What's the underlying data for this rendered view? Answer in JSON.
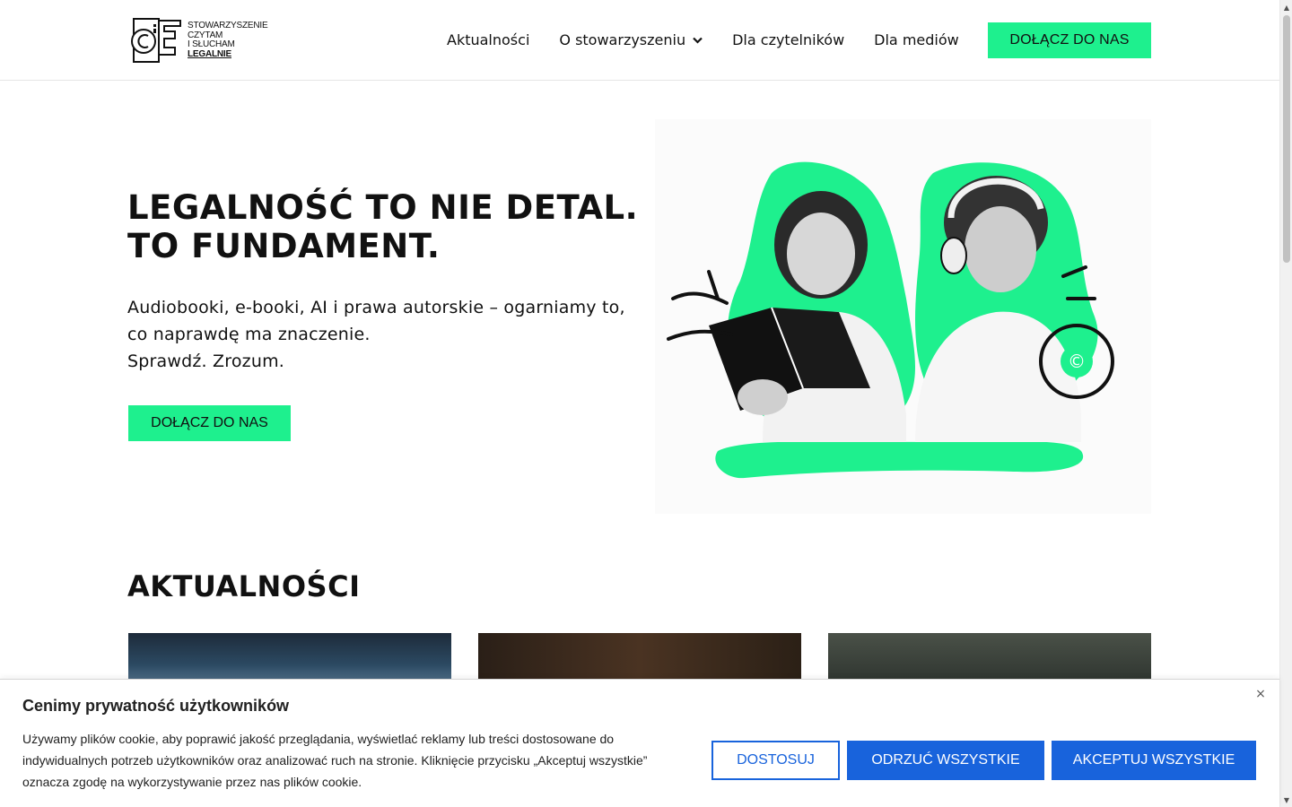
{
  "brand": {
    "logo_lines": [
      "STOWARZYSZENIE",
      "CZYTAM",
      "I SŁUCHAM"
    ],
    "logo_bold": "LEGALNIE"
  },
  "nav": {
    "items": [
      {
        "label": "Aktualności"
      },
      {
        "label": "O stowarzyszeniu",
        "has_dropdown": true
      },
      {
        "label": "Dla czytelników"
      },
      {
        "label": "Dla mediów"
      }
    ],
    "cta_label": "DOŁĄCZ DO NAS"
  },
  "hero": {
    "title_lines": [
      "LEGALNOŚĆ TO NIE DETAL.",
      "TO FUNDAMENT."
    ],
    "subtitle_lines": [
      "Audiobooki, e-booki, AI i prawa autorskie – ogarniamy to,",
      "co naprawdę ma znaczenie.",
      "Sprawdź. Zrozum."
    ],
    "cta_label": "DOŁĄCZ DO NAS",
    "accent_color": "#1ef08e"
  },
  "news": {
    "title": "AKTUALNOŚCI"
  },
  "cookie_banner": {
    "title": "Cenimy prywatność użytkowników",
    "text_lines": [
      "Używamy plików cookie, aby poprawić jakość przeglądania, wyświetlać reklamy lub treści dostosowane do",
      "indywidualnych potrzeb użytkowników oraz analizować ruch na stronie. Kliknięcie przycisku „Akceptuj wszystkie”",
      "oznacza zgodę na wykorzystywanie przez nas plików cookie."
    ],
    "close_icon": "×",
    "customize_label": "DOSTOSUJ",
    "reject_label": "ODRZUĆ WSZYSTKIE",
    "accept_label": "AKCEPTUJ WSZYSTKIE",
    "button_color": "#1863dc"
  }
}
